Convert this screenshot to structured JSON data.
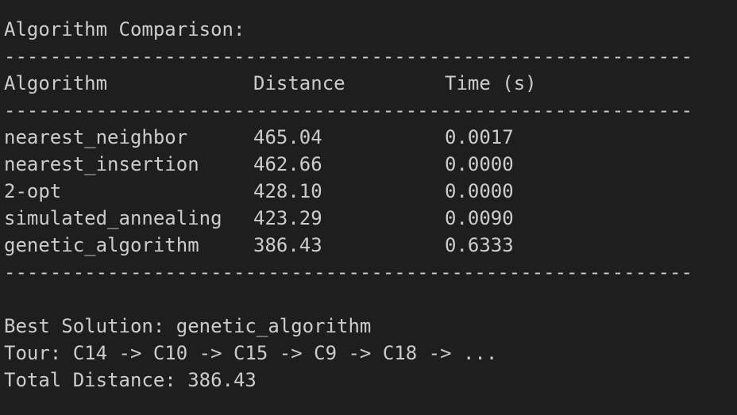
{
  "title": "Algorithm Comparison:",
  "separator": "------------------------------------------------------------",
  "table": {
    "headers": [
      "Algorithm",
      "Distance",
      "Time (s)"
    ],
    "rows": [
      {
        "algorithm": "nearest_neighbor",
        "distance": "465.04",
        "time": "0.0017"
      },
      {
        "algorithm": "nearest_insertion",
        "distance": "462.66",
        "time": "0.0000"
      },
      {
        "algorithm": "2-opt",
        "distance": "428.10",
        "time": "0.0000"
      },
      {
        "algorithm": "simulated_annealing",
        "distance": "423.29",
        "time": "0.0090"
      },
      {
        "algorithm": "genetic_algorithm",
        "distance": "386.43",
        "time": "0.6333"
      }
    ]
  },
  "summary": {
    "best_solution": "Best Solution: genetic_algorithm",
    "tour": "Tour: C14 -> C10 -> C15 -> C9 -> C18 -> ...",
    "total_distance": "Total Distance: 386.43"
  }
}
